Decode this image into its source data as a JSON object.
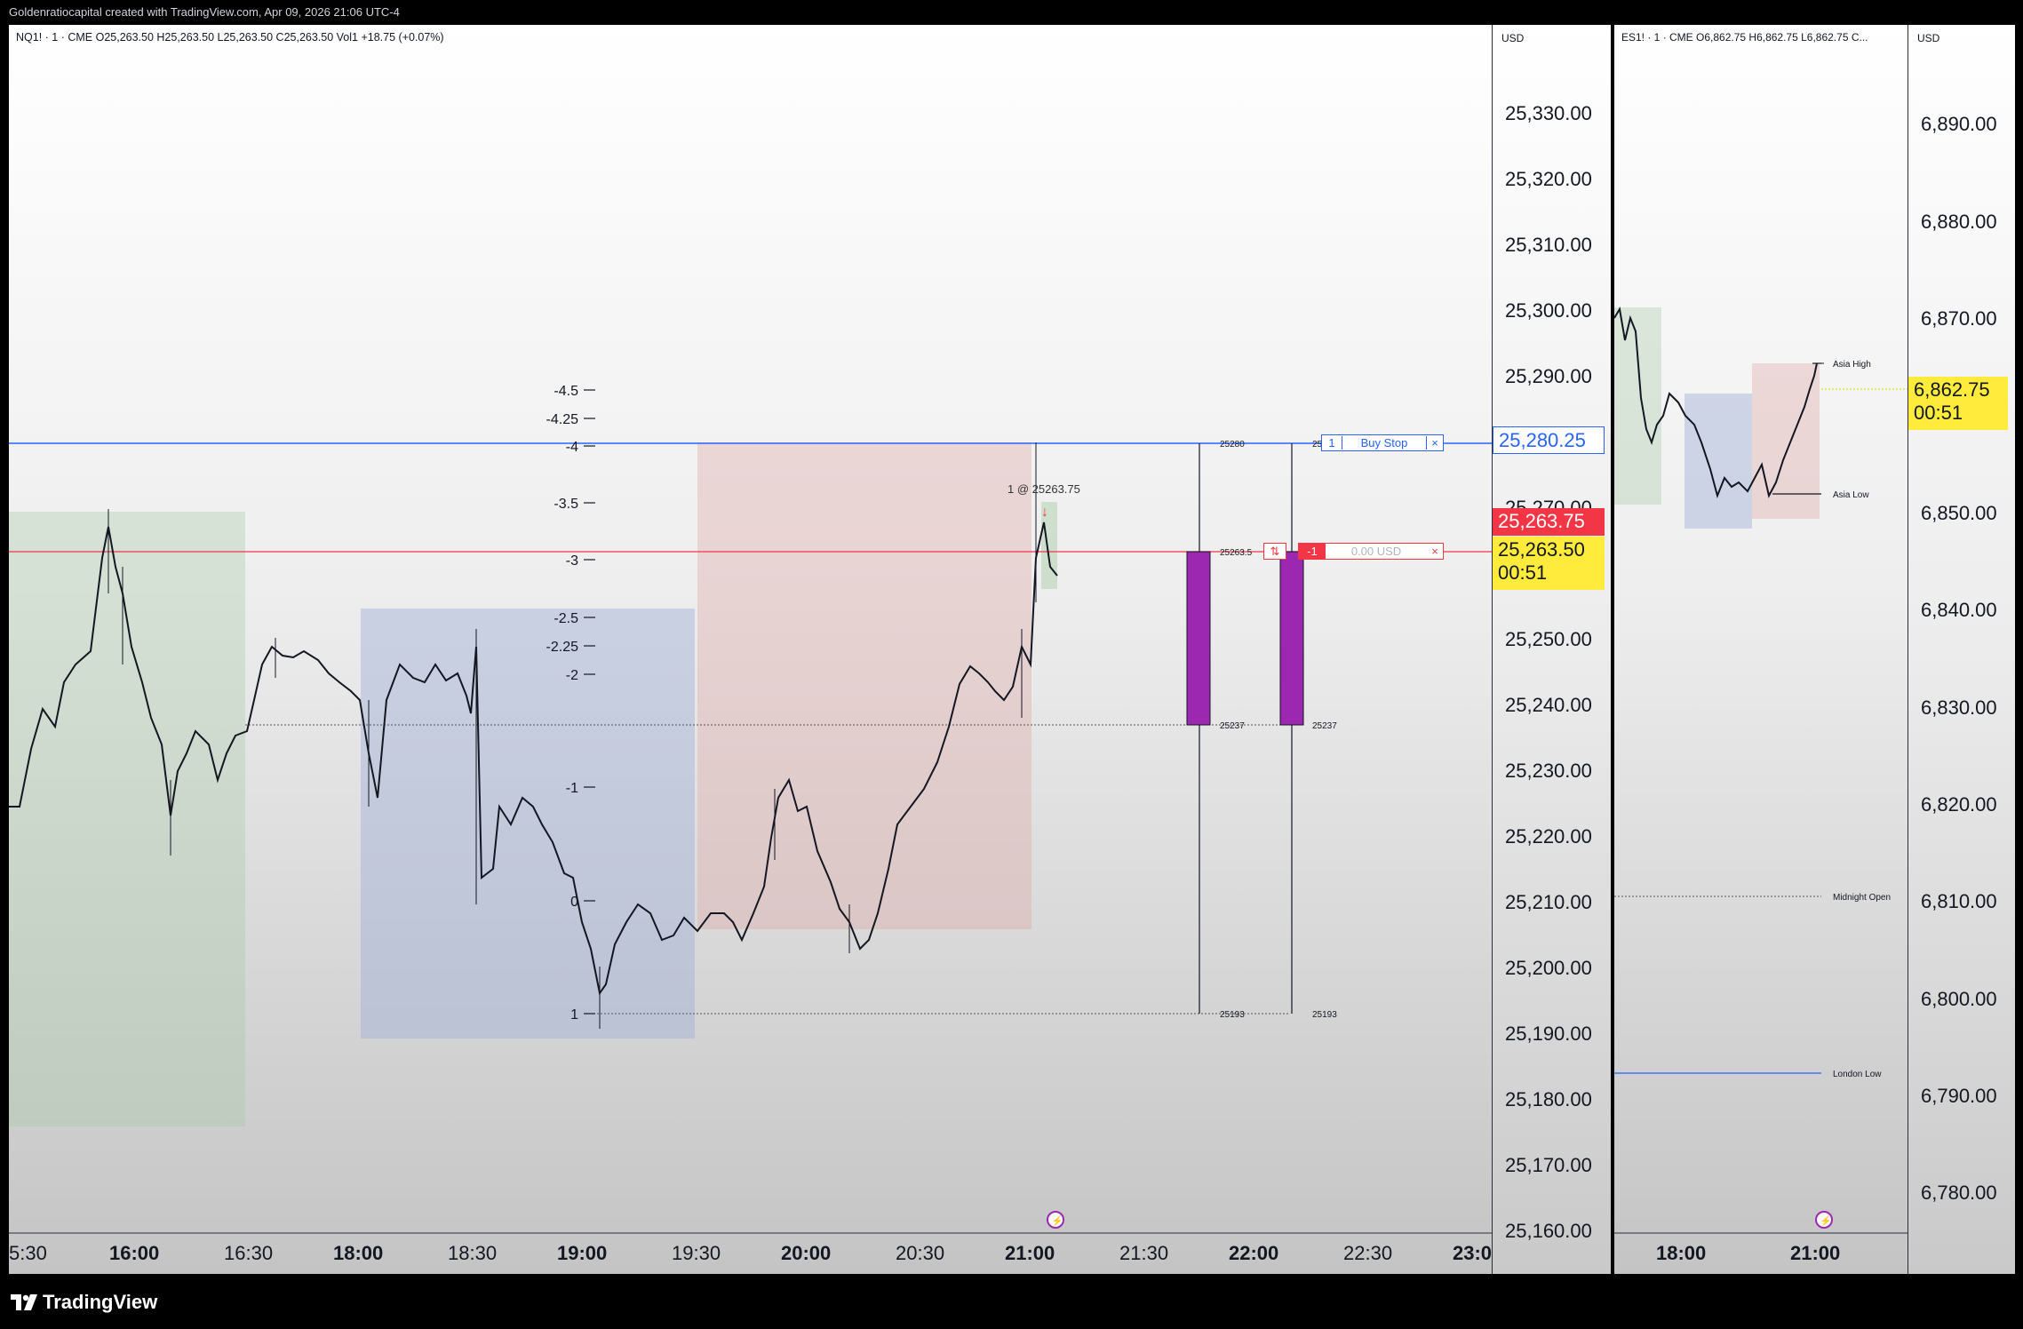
{
  "header": {
    "created_by": "Goldenratiocapital created with TradingView.com, Apr 09, 2026 21:06 UTC-4"
  },
  "branding": {
    "logo_text": "TradingView",
    "icon": "tradingview-logo-icon"
  },
  "main_chart": {
    "legend": "NQ1! · 1 · CME  O25,263.50  H25,263.50  L25,263.50  C25,263.50  Vol1  +18.75 (+0.07%)",
    "currency": "USD",
    "price_axis": [
      "25,330.00",
      "25,320.00",
      "25,310.00",
      "25,300.00",
      "25,290.00",
      "25,270.00",
      "25,250.00",
      "25,240.00",
      "25,230.00",
      "25,220.00",
      "25,210.00",
      "25,200.00",
      "25,190.00",
      "25,180.00",
      "25,170.00",
      "25,160.00"
    ],
    "time_axis": [
      "5:30",
      "16:00",
      "16:30",
      "18:00",
      "18:30",
      "19:00",
      "19:30",
      "20:00",
      "20:30",
      "21:00",
      "21:30",
      "22:00",
      "22:30",
      "23:0"
    ],
    "fib_levels": [
      "-4.5",
      "-4.25",
      "-4",
      "-3.5",
      "-3",
      "-2.5",
      "-2.25",
      "-2",
      "-1",
      "0",
      "1"
    ],
    "order_line": {
      "qty": "1",
      "label": "Buy Stop",
      "close": "×",
      "price": "25,280.25"
    },
    "position_line": {
      "icon": "⇅",
      "qty": "-1",
      "pnl": "0.00 USD",
      "close": "×"
    },
    "last_price": "25,263.75",
    "current_price": "25,263.50",
    "countdown": "00:51",
    "fill_label": "1 @ 25263.75",
    "level_labels": {
      "top_a": "25280",
      "top_b": "25",
      "mid": "25263.5",
      "low": "25237",
      "low_b": "25237",
      "bottom": "25193",
      "bottom_b": "25193"
    },
    "colors": {
      "buy_stop": "#2962ff",
      "sell": "#f23645",
      "countdown_bg": "#ffeb3b",
      "purple": "#9c27b0"
    }
  },
  "es_chart": {
    "legend": "ES1! · 1 · CME  O6,862.75  H6,862.75  L6,862.75  C...",
    "currency": "USD",
    "price_axis": [
      "6,890.00",
      "6,880.00",
      "6,870.00",
      "6,850.00",
      "6,840.00",
      "6,830.00",
      "6,820.00",
      "6,810.00",
      "6,800.00",
      "6,790.00",
      "6,780.00"
    ],
    "time_axis": [
      "18:00",
      "21:00"
    ],
    "current_price": "6,862.75",
    "countdown": "00:51",
    "annotations": [
      "Asia High",
      "Asia Low",
      "Midnight Open",
      "London Low"
    ]
  }
}
